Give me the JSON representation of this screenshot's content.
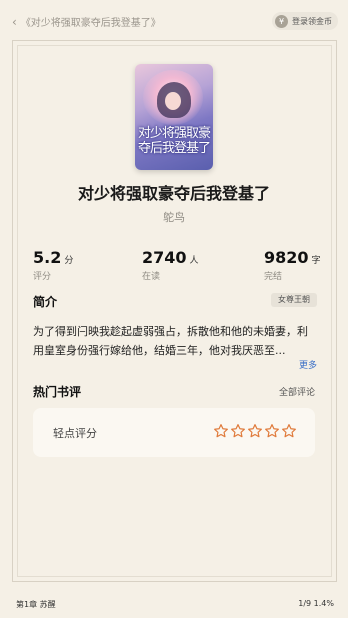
{
  "header": {
    "back_label": "《对少将强取豪夺后我登基了》",
    "coin_button_label": "登录领金币",
    "coin_icon_glyph": "¥"
  },
  "book": {
    "cover_title": "对少将强取豪夺后我登基了",
    "title": "对少将强取豪夺后我登基了",
    "author": "鸵鸟"
  },
  "stats": [
    {
      "value": "5.2",
      "unit": "分",
      "label": "评分"
    },
    {
      "value": "2740",
      "unit": "人",
      "label": "在读"
    },
    {
      "value": "9820",
      "unit": "字",
      "label": "完结"
    }
  ],
  "intro": {
    "heading": "简介",
    "tag": "女尊王朝",
    "text": "为了得到闩映我趁起虚弱强占，拆散他和他的未婚妻，利用皇室身份强行嫁给他，结婚三年，他对我厌恶至...",
    "more_label": "更多"
  },
  "reviews": {
    "heading": "热门书评",
    "all_label": "全部评论",
    "rate_label": "轻点评分",
    "star_count": 5,
    "star_color": "#e07b3c"
  },
  "footer": {
    "chapter": "第1章 苏醒",
    "progress": "1/9  1.4%"
  }
}
